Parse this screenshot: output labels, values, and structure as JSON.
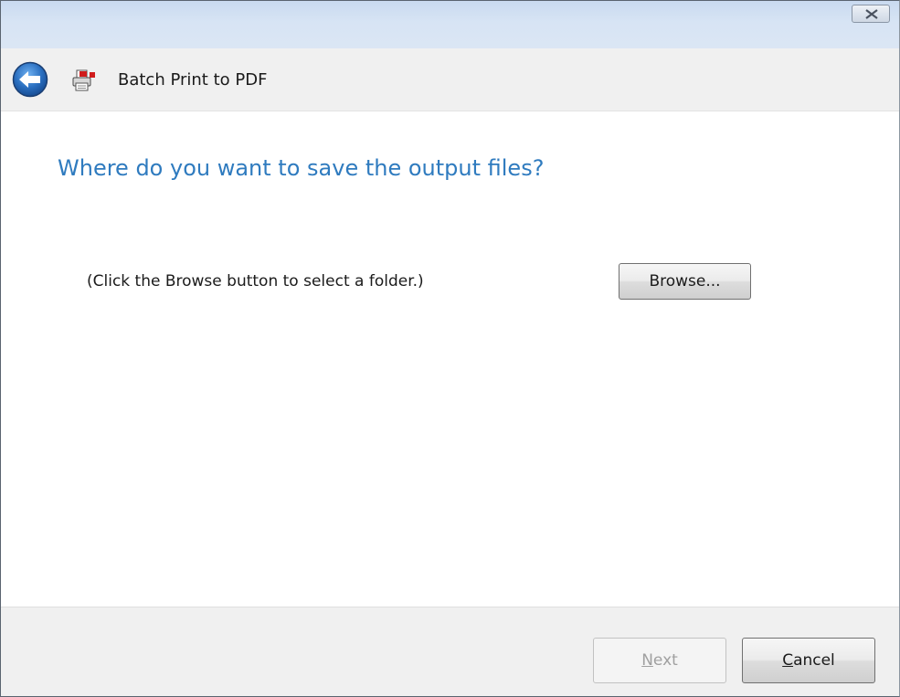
{
  "window": {
    "title_bar": {
      "close_icon": "close-x-icon"
    }
  },
  "header": {
    "back_icon": "back-arrow-icon",
    "app_icon": "pdf-printer-icon",
    "title": "Batch Print to PDF"
  },
  "main": {
    "heading": "Where do you want to save the output files?",
    "hint": "(Click the Browse button to select a folder.)",
    "browse_label": "Browse..."
  },
  "footer": {
    "next_label_mnemonic": "N",
    "next_label_rest": "ext",
    "next_enabled": false,
    "cancel_label_mnemonic": "C",
    "cancel_label_rest": "ancel"
  },
  "colors": {
    "heading": "#2f7bbf",
    "back_button": "#2a6fc0",
    "app_icon_accent": "#d01c1c"
  }
}
